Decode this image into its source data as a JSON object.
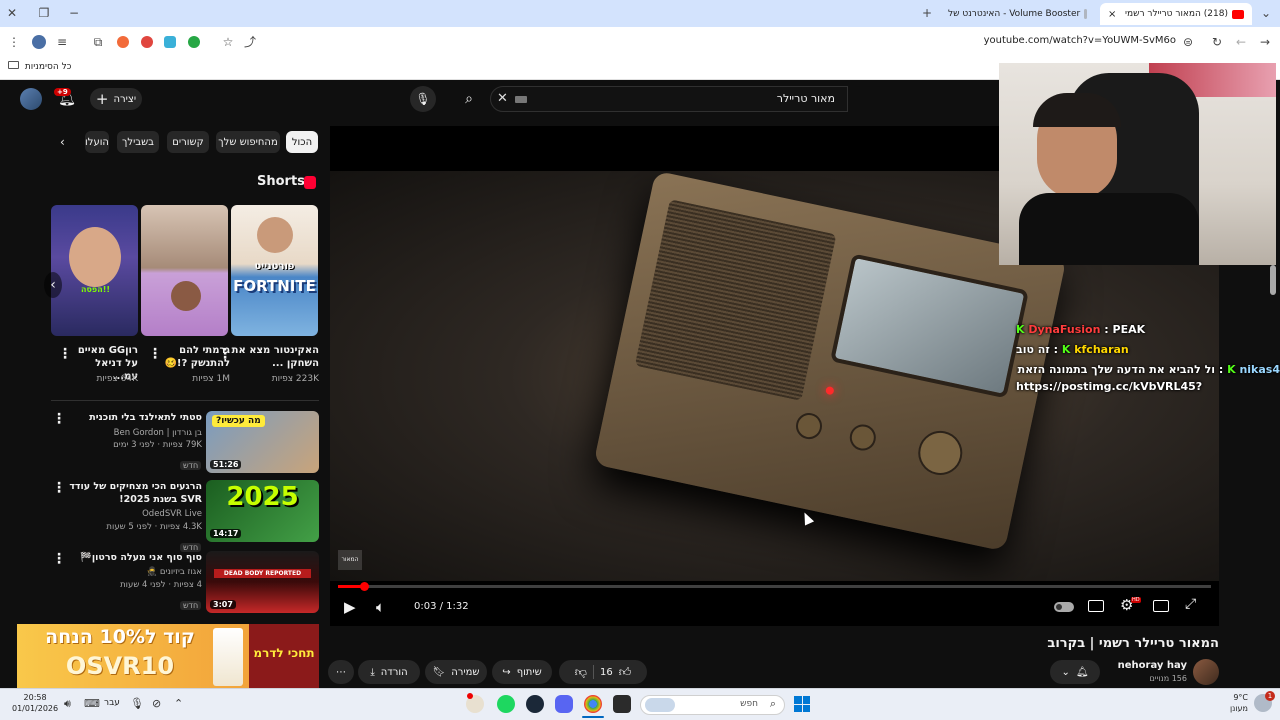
{
  "browser": {
    "tabs": [
      {
        "title": "(218) המאור טריילר רשמי",
        "active": true
      },
      {
        "title": "Volume Booster - האינטרנט של",
        "active": false
      }
    ],
    "url": "youtube.com/watch?v=YoUWM-SvM6o",
    "bookmarks_label": "כל הסימניות"
  },
  "youtube": {
    "create_label": "יצירה",
    "notif_count": "+9",
    "search_value": "מאור טריילר",
    "chips": [
      "הכול",
      "מהחיפוש שלך",
      "קשורים",
      "בשבילך",
      "הועלו"
    ],
    "shorts_heading": "Shorts",
    "shorts": [
      {
        "title": "האקינטור מצא את השחקן ...",
        "views": "223K צפיות",
        "overlay": "פורטנייט",
        "overlay2": "FORTNITE"
      },
      {
        "title": "גרמתי להם להתנשק ?!🥴",
        "views": "1M צפיות"
      },
      {
        "title": "רוןGG מאיים על דניאל עמ...",
        "views": "64K צפיות",
        "overlay": "הפסה!!"
      }
    ],
    "recommendations": [
      {
        "title": "סטתי לתאילנד בלי תוכנית",
        "channel": "בן גורדון | Ben Gordon",
        "meta": "79K צפיות · לפני 3 ימים",
        "badge": "חדש",
        "duration": "51:26",
        "thumb_text": "מה עכשיו?"
      },
      {
        "title": "הרגעים הכי מצחיקים של עודד SVR בשנת 2025!",
        "channel": "OdedSVR Live",
        "meta": "4.3K צפיות · לפני 5 שעות",
        "badge": "חדש",
        "duration": "14:17",
        "thumb_text": "2025"
      },
      {
        "title": "סוף סוף אני מעלה סרטון🏁",
        "channel": "אגוז ביזיונים 🥷",
        "meta": "4 צפיות · לפני 4 שעות",
        "badge": "חדש",
        "duration": "3:07",
        "thumb_text": "DEAD BODY REPORTED"
      }
    ],
    "ad": {
      "line1": "קוד ל10% הנחה",
      "line2": "OSVR10",
      "side": "תחכי לדרמ"
    },
    "player": {
      "time": "0:03 / 1:32",
      "progress": 0.03,
      "watermark": "המאור"
    },
    "video_title": "המאור טריילר רשמי | בקרוב",
    "channel_name": "nehoray hay",
    "subscribers": "156 מנויים",
    "likes": "16",
    "share_label": "שיתוף",
    "save_label": "שמירה",
    "download_label": "הורדה"
  },
  "stream_chat": [
    {
      "user": "DynaFusion",
      "text": ": PEAK",
      "user_color": "#ff3d3d"
    },
    {
      "user": "kfcharan",
      "text": ": זה טוב",
      "user_color": "#ffd700"
    },
    {
      "user": "nikas4",
      "text": ": ול להביא את הדעה שלך בתמונה הזאת",
      "user_color": "#9ad7ff"
    },
    {
      "user": "",
      "text": "https://postimg.cc/kVbVRL45?",
      "user_color": "#ffffff"
    }
  ],
  "taskbar": {
    "time": "20:58",
    "date": "01/01/2026",
    "lang": "עבר",
    "search_placeholder": "חפש",
    "weather_temp": "9°C",
    "weather_desc": "מעונן",
    "weather_badge": "1"
  }
}
